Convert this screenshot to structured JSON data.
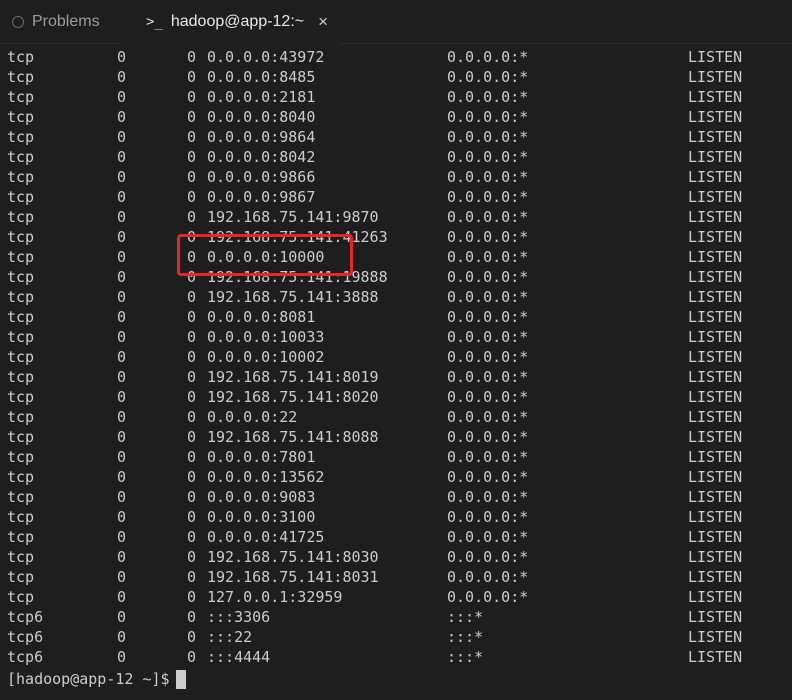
{
  "tabs": {
    "problems_label": "Problems",
    "terminal_icon": ">_",
    "terminal_label": "hadoop@app-12:~",
    "close_glyph": "×"
  },
  "terminal": {
    "rows": [
      {
        "proto": "tcp",
        "recvq": "0",
        "sendq": "0",
        "local": "0.0.0.0:43972",
        "foreign": "0.0.0.0:*",
        "state": "LISTEN"
      },
      {
        "proto": "tcp",
        "recvq": "0",
        "sendq": "0",
        "local": "0.0.0.0:8485",
        "foreign": "0.0.0.0:*",
        "state": "LISTEN"
      },
      {
        "proto": "tcp",
        "recvq": "0",
        "sendq": "0",
        "local": "0.0.0.0:2181",
        "foreign": "0.0.0.0:*",
        "state": "LISTEN"
      },
      {
        "proto": "tcp",
        "recvq": "0",
        "sendq": "0",
        "local": "0.0.0.0:8040",
        "foreign": "0.0.0.0:*",
        "state": "LISTEN"
      },
      {
        "proto": "tcp",
        "recvq": "0",
        "sendq": "0",
        "local": "0.0.0.0:9864",
        "foreign": "0.0.0.0:*",
        "state": "LISTEN"
      },
      {
        "proto": "tcp",
        "recvq": "0",
        "sendq": "0",
        "local": "0.0.0.0:8042",
        "foreign": "0.0.0.0:*",
        "state": "LISTEN"
      },
      {
        "proto": "tcp",
        "recvq": "0",
        "sendq": "0",
        "local": "0.0.0.0:9866",
        "foreign": "0.0.0.0:*",
        "state": "LISTEN"
      },
      {
        "proto": "tcp",
        "recvq": "0",
        "sendq": "0",
        "local": "0.0.0.0:9867",
        "foreign": "0.0.0.0:*",
        "state": "LISTEN"
      },
      {
        "proto": "tcp",
        "recvq": "0",
        "sendq": "0",
        "local": "192.168.75.141:9870",
        "foreign": "0.0.0.0:*",
        "state": "LISTEN"
      },
      {
        "proto": "tcp",
        "recvq": "0",
        "sendq": "0",
        "local": "192.168.75.141:41263",
        "foreign": "0.0.0.0:*",
        "state": "LISTEN"
      },
      {
        "proto": "tcp",
        "recvq": "0",
        "sendq": "0",
        "local": "0.0.0.0:10000",
        "foreign": "0.0.0.0:*",
        "state": "LISTEN"
      },
      {
        "proto": "tcp",
        "recvq": "0",
        "sendq": "0",
        "local": "192.168.75.141:19888",
        "foreign": "0.0.0.0:*",
        "state": "LISTEN"
      },
      {
        "proto": "tcp",
        "recvq": "0",
        "sendq": "0",
        "local": "192.168.75.141:3888",
        "foreign": "0.0.0.0:*",
        "state": "LISTEN"
      },
      {
        "proto": "tcp",
        "recvq": "0",
        "sendq": "0",
        "local": "0.0.0.0:8081",
        "foreign": "0.0.0.0:*",
        "state": "LISTEN"
      },
      {
        "proto": "tcp",
        "recvq": "0",
        "sendq": "0",
        "local": "0.0.0.0:10033",
        "foreign": "0.0.0.0:*",
        "state": "LISTEN"
      },
      {
        "proto": "tcp",
        "recvq": "0",
        "sendq": "0",
        "local": "0.0.0.0:10002",
        "foreign": "0.0.0.0:*",
        "state": "LISTEN"
      },
      {
        "proto": "tcp",
        "recvq": "0",
        "sendq": "0",
        "local": "192.168.75.141:8019",
        "foreign": "0.0.0.0:*",
        "state": "LISTEN"
      },
      {
        "proto": "tcp",
        "recvq": "0",
        "sendq": "0",
        "local": "192.168.75.141:8020",
        "foreign": "0.0.0.0:*",
        "state": "LISTEN"
      },
      {
        "proto": "tcp",
        "recvq": "0",
        "sendq": "0",
        "local": "0.0.0.0:22",
        "foreign": "0.0.0.0:*",
        "state": "LISTEN"
      },
      {
        "proto": "tcp",
        "recvq": "0",
        "sendq": "0",
        "local": "192.168.75.141:8088",
        "foreign": "0.0.0.0:*",
        "state": "LISTEN"
      },
      {
        "proto": "tcp",
        "recvq": "0",
        "sendq": "0",
        "local": "0.0.0.0:7801",
        "foreign": "0.0.0.0:*",
        "state": "LISTEN"
      },
      {
        "proto": "tcp",
        "recvq": "0",
        "sendq": "0",
        "local": "0.0.0.0:13562",
        "foreign": "0.0.0.0:*",
        "state": "LISTEN"
      },
      {
        "proto": "tcp",
        "recvq": "0",
        "sendq": "0",
        "local": "0.0.0.0:9083",
        "foreign": "0.0.0.0:*",
        "state": "LISTEN"
      },
      {
        "proto": "tcp",
        "recvq": "0",
        "sendq": "0",
        "local": "0.0.0.0:3100",
        "foreign": "0.0.0.0:*",
        "state": "LISTEN"
      },
      {
        "proto": "tcp",
        "recvq": "0",
        "sendq": "0",
        "local": "0.0.0.0:41725",
        "foreign": "0.0.0.0:*",
        "state": "LISTEN"
      },
      {
        "proto": "tcp",
        "recvq": "0",
        "sendq": "0",
        "local": "192.168.75.141:8030",
        "foreign": "0.0.0.0:*",
        "state": "LISTEN"
      },
      {
        "proto": "tcp",
        "recvq": "0",
        "sendq": "0",
        "local": "192.168.75.141:8031",
        "foreign": "0.0.0.0:*",
        "state": "LISTEN"
      },
      {
        "proto": "tcp",
        "recvq": "0",
        "sendq": "0",
        "local": "127.0.0.1:32959",
        "foreign": "0.0.0.0:*",
        "state": "LISTEN"
      },
      {
        "proto": "tcp6",
        "recvq": "0",
        "sendq": "0",
        "local": ":::3306",
        "foreign": ":::*",
        "state": "LISTEN"
      },
      {
        "proto": "tcp6",
        "recvq": "0",
        "sendq": "0",
        "local": ":::22",
        "foreign": ":::*",
        "state": "LISTEN"
      },
      {
        "proto": "tcp6",
        "recvq": "0",
        "sendq": "0",
        "local": ":::4444",
        "foreign": ":::*",
        "state": "LISTEN"
      }
    ],
    "prompt": "[hadoop@app-12 ~]$"
  },
  "colors": {
    "background": "#1e1e1e",
    "text": "#cccccc",
    "highlight": "#e5262a"
  }
}
